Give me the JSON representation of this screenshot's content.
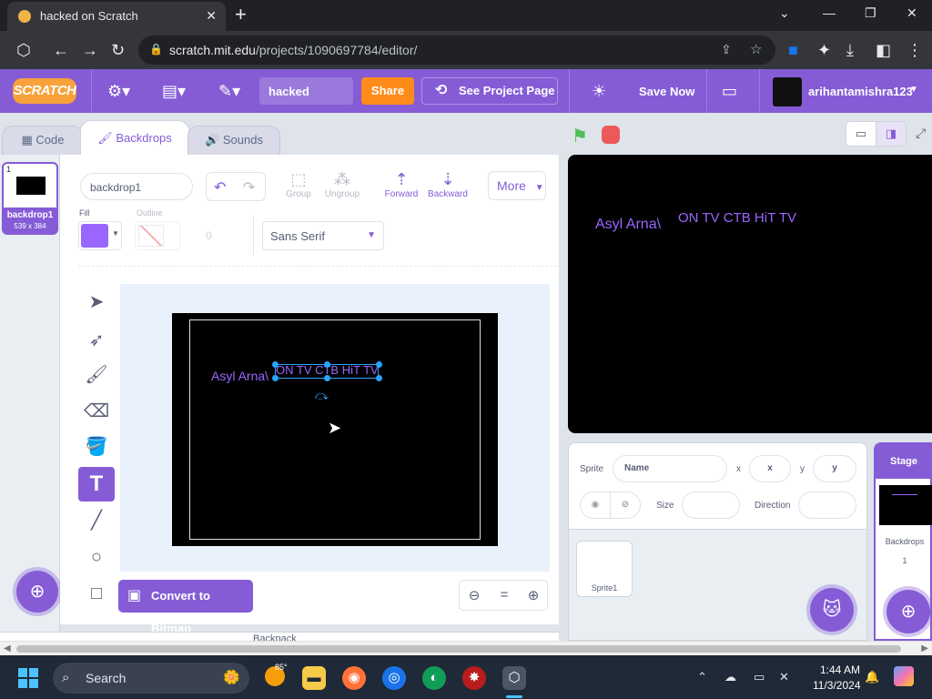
{
  "browser": {
    "tab_title": "hacked on Scratch",
    "url_host": "scratch.mit.edu",
    "url_path": "/projects/1090697784/editor/"
  },
  "menubar": {
    "logo": "SCRATCH",
    "project_title": "hacked",
    "share_label": "Share",
    "see_project_label": "See Project Page",
    "save_now_label": "Save Now",
    "username": "arihantamishra123"
  },
  "tabs": [
    {
      "label": "Code"
    },
    {
      "label": "Backdrops"
    },
    {
      "label": "Sounds"
    }
  ],
  "costume_list": {
    "item": {
      "number": "1",
      "name": "backdrop1",
      "size": "539 x 384"
    }
  },
  "paint_editor": {
    "backdrop_name": "backdrop1",
    "group_label": "Group",
    "ungroup_label": "Ungroup",
    "forward_label": "Forward",
    "backward_label": "Backward",
    "more_label": "More",
    "fill_label": "Fill",
    "outline_label": "Outline",
    "outline_width": "0",
    "font": "Sans Serif",
    "convert_label": "Convert to Bitmap",
    "zoom_reset": "="
  },
  "artwork": {
    "text1": "Asyl Arna\\",
    "text2": "ON TV CTB HiT TV"
  },
  "sprite_info": {
    "sprite_label": "Sprite",
    "name_placeholder": "Name",
    "x_label": "x",
    "x_placeholder": "x",
    "y_label": "y",
    "y_placeholder": "y",
    "size_label": "Size",
    "direction_label": "Direction",
    "sprite_name": "Sprite1"
  },
  "stage_panel": {
    "title": "Stage",
    "backdrops_label": "Backdrops",
    "backdrops_count": "1"
  },
  "backpack_label": "Backpack",
  "taskbar": {
    "search_label": "Search",
    "weather_temp": "85°",
    "time": "1:44 AM",
    "date": "11/3/2024"
  },
  "colors": {
    "scratch_purple": "#855cd6",
    "share_orange": "#ff8c1a",
    "fill_color": "#9966ff"
  }
}
